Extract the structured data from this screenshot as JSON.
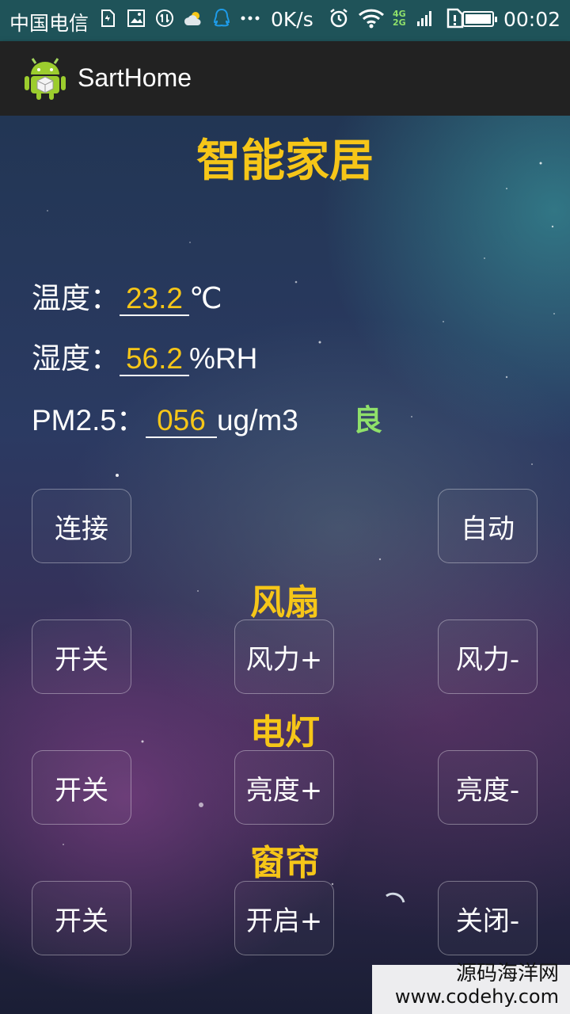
{
  "status_bar": {
    "carrier": "中国电信",
    "speed": "0K/s",
    "time": "00:02",
    "network_top": "4G",
    "network_bottom": "2G"
  },
  "action_bar": {
    "title": "SartHome"
  },
  "main": {
    "title": "智能家居",
    "temperature": {
      "label": "温度：",
      "value": "23.2",
      "unit": "℃"
    },
    "humidity": {
      "label": "湿度：",
      "value": "56.2",
      "unit": "%RH"
    },
    "pm25": {
      "label": "PM2.5：",
      "value": "056",
      "unit": "ug/m3",
      "quality": "良"
    },
    "connect_button": "连接",
    "auto_button": "自动",
    "fan": {
      "title": "风扇",
      "toggle": "开关",
      "increase": "风力+",
      "decrease": "风力-"
    },
    "light": {
      "title": "电灯",
      "toggle": "开关",
      "increase": "亮度+",
      "decrease": "亮度-"
    },
    "curtain": {
      "title": "窗帘",
      "toggle": "开关",
      "open": "开启+",
      "close": "关闭-"
    }
  },
  "watermark": {
    "line1": "源码海洋网",
    "line2": "www.codehy.com"
  },
  "colors": {
    "accent": "#f6c618",
    "quality_good": "#8fe06a",
    "statusbar": "#1f5359",
    "actionbar": "#222222"
  }
}
